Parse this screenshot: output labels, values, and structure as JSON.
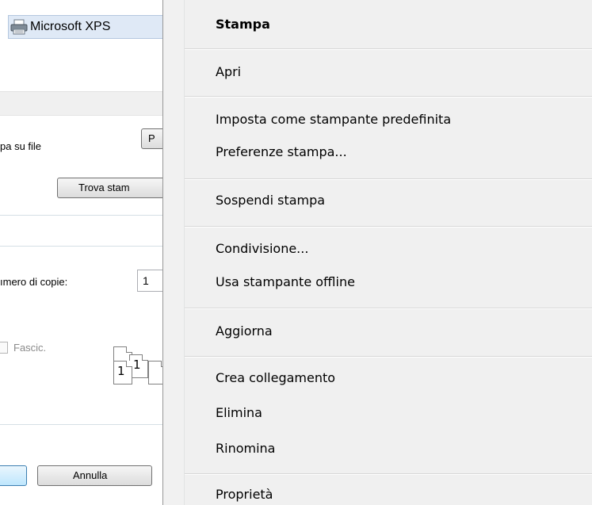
{
  "dialog": {
    "printer_name": "Microsoft XPS",
    "print_to_file": "pa su file",
    "preferences_button": "P",
    "find_printer_button": "Trova stam",
    "copies_label": "ımero di copie:",
    "copies_value": "1",
    "collate_label": "Fascic.",
    "collate_page1": "1",
    "collate_page2": "1",
    "cancel_button": "Annulla"
  },
  "menu": {
    "items": [
      "Stampa",
      "Apri",
      "Imposta come stampante predefinita",
      "Preferenze stampa...",
      "Sospendi stampa",
      "Condivisione...",
      "Usa stampante offline",
      "Aggiorna",
      "Crea collegamento",
      "Elimina",
      "Rinomina",
      "Proprietà"
    ],
    "default_item": "Stampa"
  },
  "colors": {
    "menu_background": "#f0f0f0",
    "separator": "#d7d7d7",
    "selection_background": "#dfe9f6"
  }
}
